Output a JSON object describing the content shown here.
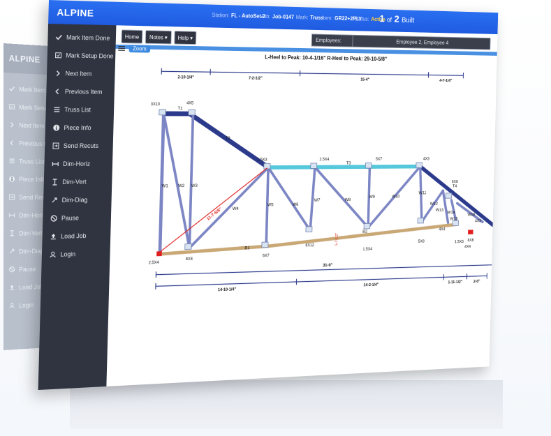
{
  "bg_screen": {
    "brand": "ALPINE",
    "items": [
      {
        "label": "Mark Item Done",
        "icon": "check-icon"
      },
      {
        "label": "Mark Setup Done",
        "icon": "setup-icon"
      },
      {
        "label": "Next Item",
        "icon": "chevron-right-icon"
      },
      {
        "label": "Previous Item",
        "icon": "chevron-left-icon"
      },
      {
        "label": "Truss List",
        "icon": "list-icon"
      },
      {
        "label": "Piece Info",
        "icon": "info-icon"
      },
      {
        "label": "Send Recuts",
        "icon": "send-icon"
      },
      {
        "label": "Dim-Horiz",
        "icon": "dim-horiz-icon"
      },
      {
        "label": "Dim-Vert",
        "icon": "dim-vert-icon"
      },
      {
        "label": "Dim-Diag",
        "icon": "dim-diag-icon"
      },
      {
        "label": "Pause",
        "icon": "pause-icon"
      },
      {
        "label": "Load Job",
        "icon": "upload-icon"
      },
      {
        "label": "Login",
        "icon": "user-icon"
      }
    ]
  },
  "topbar": {
    "brand": "ALPINE",
    "station_label": "Station:",
    "station_value": "FL - AutoSet-2",
    "job_label": "Job:",
    "job_value": "Job-0147",
    "mark_label": "Mark:",
    "mark_value": "Truss",
    "item_label": "Item:",
    "item_value": "GR22+2PLY",
    "status_label": "Status:",
    "status_value": "Active",
    "built_count": "1",
    "built_of": "of",
    "built_total": "2",
    "built_label": "Built"
  },
  "sidebar": {
    "items": [
      {
        "label": "Mark Item Done",
        "icon": "check-icon"
      },
      {
        "label": "Mark Setup Done",
        "icon": "setup-icon"
      },
      {
        "label": "Next Item",
        "icon": "chevron-right-icon"
      },
      {
        "label": "Previous Item",
        "icon": "chevron-left-icon"
      },
      {
        "label": "Truss List",
        "icon": "list-icon"
      },
      {
        "label": "Piece Info",
        "icon": "info-icon"
      },
      {
        "label": "Send Recuts",
        "icon": "send-icon"
      },
      {
        "label": "Dim-Horiz",
        "icon": "dim-horiz-icon"
      },
      {
        "label": "Dim-Vert",
        "icon": "dim-vert-icon"
      },
      {
        "label": "Dim-Diag",
        "icon": "dim-diag-icon"
      },
      {
        "label": "Pause",
        "icon": "pause-icon"
      },
      {
        "label": "Load Job",
        "icon": "upload-icon"
      },
      {
        "label": "Login",
        "icon": "user-icon"
      }
    ]
  },
  "toolbar": {
    "home_label": "Home",
    "notes_label": "Notes ▾",
    "help_label": "Help ▾",
    "employees_label": "Employees:",
    "employees_value": "Employee 2, Employee 4",
    "zoom_label": "Zoom"
  },
  "drawing": {
    "title": "L-Heel to Peak: 10-4-1/16\"  R-Heel to Peak: 29-10-5/8\"",
    "colors": {
      "top_chord": "#2c3a8c",
      "web": "#7d86c4",
      "bottom_chord": "#c9a876",
      "highlight": "#56c8dc",
      "dim": "#2c3a8c",
      "red": "#e02020"
    },
    "top_dims": [
      "2-10-1/4\"",
      "7-2-1/2\"",
      "15-4\"",
      "4-7-1/4\""
    ],
    "bottom_dims": [
      "31-0\"",
      "14-10-1/4\"",
      "14-2-1/4\"",
      "1-11-1/2\"",
      "2-0\""
    ],
    "member_labels": [
      "T1",
      "T2",
      "T3",
      "T4",
      "B1",
      "B2",
      "W1",
      "W2",
      "W3",
      "W4",
      "W5",
      "W6",
      "W7",
      "W8",
      "W9",
      "W10",
      "W11",
      "W12",
      "W13",
      "W14",
      "W15",
      "W16"
    ],
    "plates": [
      "3X10",
      "4X5",
      "1.5X3",
      "2.5X4",
      "5X7",
      "4X3",
      "6X8",
      "2.5X4",
      "8X8",
      "6X7",
      "6X12",
      "1.5X4",
      "5X8",
      "4X4",
      "1.5X3",
      "4X4",
      "8X8",
      "4X3"
    ],
    "diag_measure": "11-7-5/8\"",
    "vert_measure": "5-7-1/2\""
  }
}
